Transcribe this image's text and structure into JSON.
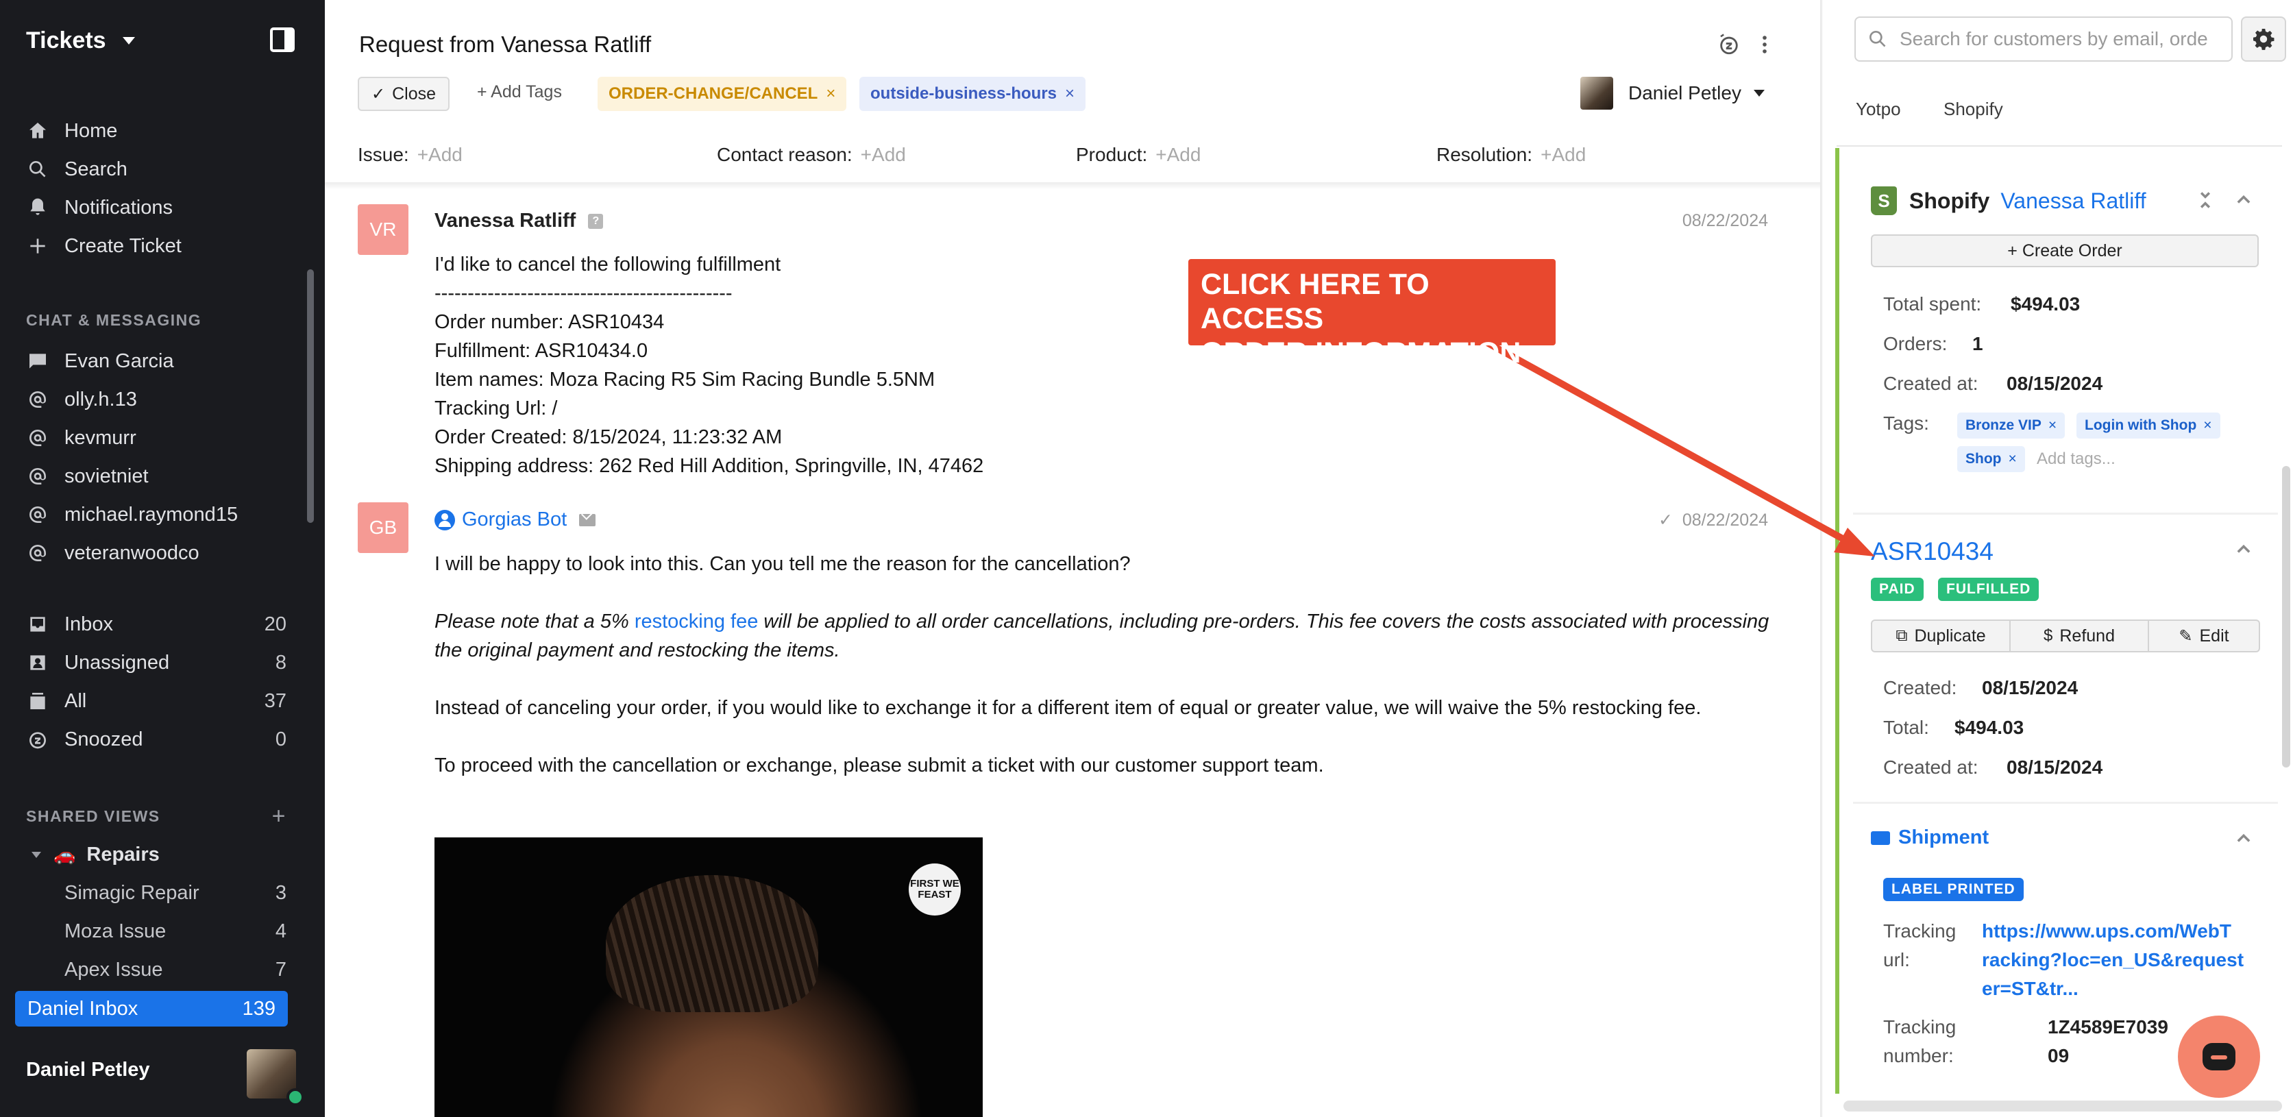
{
  "sidebar": {
    "title": "Tickets",
    "primary": [
      {
        "label": "Home",
        "icon": "home-icon"
      },
      {
        "label": "Search",
        "icon": "search-icon"
      },
      {
        "label": "Notifications",
        "icon": "bell-icon"
      },
      {
        "label": "Create Ticket",
        "icon": "plus-icon"
      }
    ],
    "chat_heading": "CHAT & MESSAGING",
    "chat": [
      {
        "label": "Evan Garcia",
        "icon": "chat-icon"
      },
      {
        "label": "olly.h.13",
        "icon": "instagram-icon"
      },
      {
        "label": "kevmurr",
        "icon": "instagram-icon"
      },
      {
        "label": "sovietniet",
        "icon": "instagram-icon"
      },
      {
        "label": "michael.raymond15",
        "icon": "instagram-icon"
      },
      {
        "label": "veteranwoodco",
        "icon": "instagram-icon"
      }
    ],
    "views": [
      {
        "label": "Inbox",
        "count": "20",
        "icon": "inbox-icon"
      },
      {
        "label": "Unassigned",
        "count": "8",
        "icon": "unassigned-icon"
      },
      {
        "label": "All",
        "count": "37",
        "icon": "all-icon"
      },
      {
        "label": "Snoozed",
        "count": "0",
        "icon": "snooze-icon"
      }
    ],
    "shared_heading": "SHARED VIEWS",
    "shared_add": "+",
    "repairs_label": "Repairs",
    "repairs_emoji": "🚗",
    "repairs_children": [
      {
        "label": "Simagic Repair",
        "count": "3"
      },
      {
        "label": "Moza Issue",
        "count": "4"
      },
      {
        "label": "Apex Issue",
        "count": "7"
      }
    ],
    "active": {
      "label": "Daniel Inbox",
      "count": "139"
    },
    "user_name": "Daniel Petley"
  },
  "ticket": {
    "title": "Request from Vanessa Ratliff",
    "close_label": "Close",
    "add_tags_label": "+ Add Tags",
    "tags": [
      {
        "label": "ORDER-CHANGE/CANCEL",
        "x": "×"
      },
      {
        "label": "outside-business-hours",
        "x": "×"
      }
    ],
    "assignee": "Daniel Petley",
    "fields": [
      {
        "label": "Issue:",
        "add": "+Add"
      },
      {
        "label": "Contact reason:",
        "add": "+Add"
      },
      {
        "label": "Product:",
        "add": "+Add"
      },
      {
        "label": "Resolution:",
        "add": "+Add"
      }
    ]
  },
  "messages": [
    {
      "initials": "VR",
      "author": "Vanessa Ratliff",
      "date": "08/22/2024",
      "lines": [
        "I'd like to cancel the following fulfillment",
        "---------------------------------------------",
        "Order number: ASR10434",
        "Fulfillment: ASR10434.0",
        "Item names: Moza Racing R5 Sim Racing Bundle 5.5NM",
        "Tracking Url: /",
        "Order Created: 8/15/2024, 11:23:32 AM",
        "Shipping address: 262 Red Hill Addition, Springville, IN, 47462"
      ]
    },
    {
      "initials": "GB",
      "author": "Gorgias Bot",
      "date": "08/22/2024",
      "check": "✓",
      "p1": "I will be happy to look into this. Can you tell me the reason for the cancellation?",
      "p2_a": "Please note that a 5% ",
      "p2_link": "restocking fee",
      "p2_b": " will be applied to all order cancellations, including pre-orders. This fee covers the costs associated with processing the original payment and restocking the items.",
      "p3": "Instead of canceling your order, if you would like to exchange it for a different item of equal or greater value, we will waive the 5% restocking fee.",
      "p4": "To proceed with the cancellation or exchange, please submit a ticket with our customer support team.",
      "gif_badge": "FIRST WE FEAST"
    }
  ],
  "callout": {
    "line1": "CLICK HERE TO ACCESS",
    "line2": "ORDER INFORMATION",
    "color": "#e8482e"
  },
  "right_panel": {
    "search_placeholder": "Search for customers by email, orde",
    "tabs": [
      "Yotpo",
      "Shopify"
    ],
    "shopify": {
      "name": "Shopify",
      "customer": "Vanessa Ratliff",
      "create_order": "+ Create Order",
      "total_spent_label": "Total spent:",
      "total_spent": "$494.03",
      "orders_label": "Orders:",
      "orders": "1",
      "created_label": "Created at:",
      "created": "08/15/2024",
      "tags_label": "Tags:",
      "tags": [
        {
          "label": "Bronze VIP",
          "x": "×"
        },
        {
          "label": "Login with Shop",
          "x": "×"
        },
        {
          "label": "Shop",
          "x": "×"
        }
      ],
      "add_tags_placeholder": "Add tags..."
    },
    "order": {
      "id": "ASR10434",
      "badges": [
        "PAID",
        "FULFILLED"
      ],
      "actions": [
        "Duplicate",
        "Refund",
        "Edit"
      ],
      "created_label": "Created:",
      "created": "08/15/2024",
      "total_label": "Total:",
      "total": "$494.03",
      "created_at_label": "Created at:",
      "created_at": "08/15/2024"
    },
    "shipment": {
      "title": "Shipment",
      "status": "LABEL PRINTED",
      "tracking_url_label_1": "Tracking",
      "tracking_url_label_2": "url:",
      "tracking_url_lines": [
        "https://www.ups.com/WebT",
        "racking?loc=en_US&request",
        "er=ST&tr..."
      ],
      "tracking_number_label_1": "Tracking",
      "tracking_number_label_2": "number:",
      "tracking_number_lines": [
        "1Z4589E7039",
        "09"
      ]
    }
  }
}
